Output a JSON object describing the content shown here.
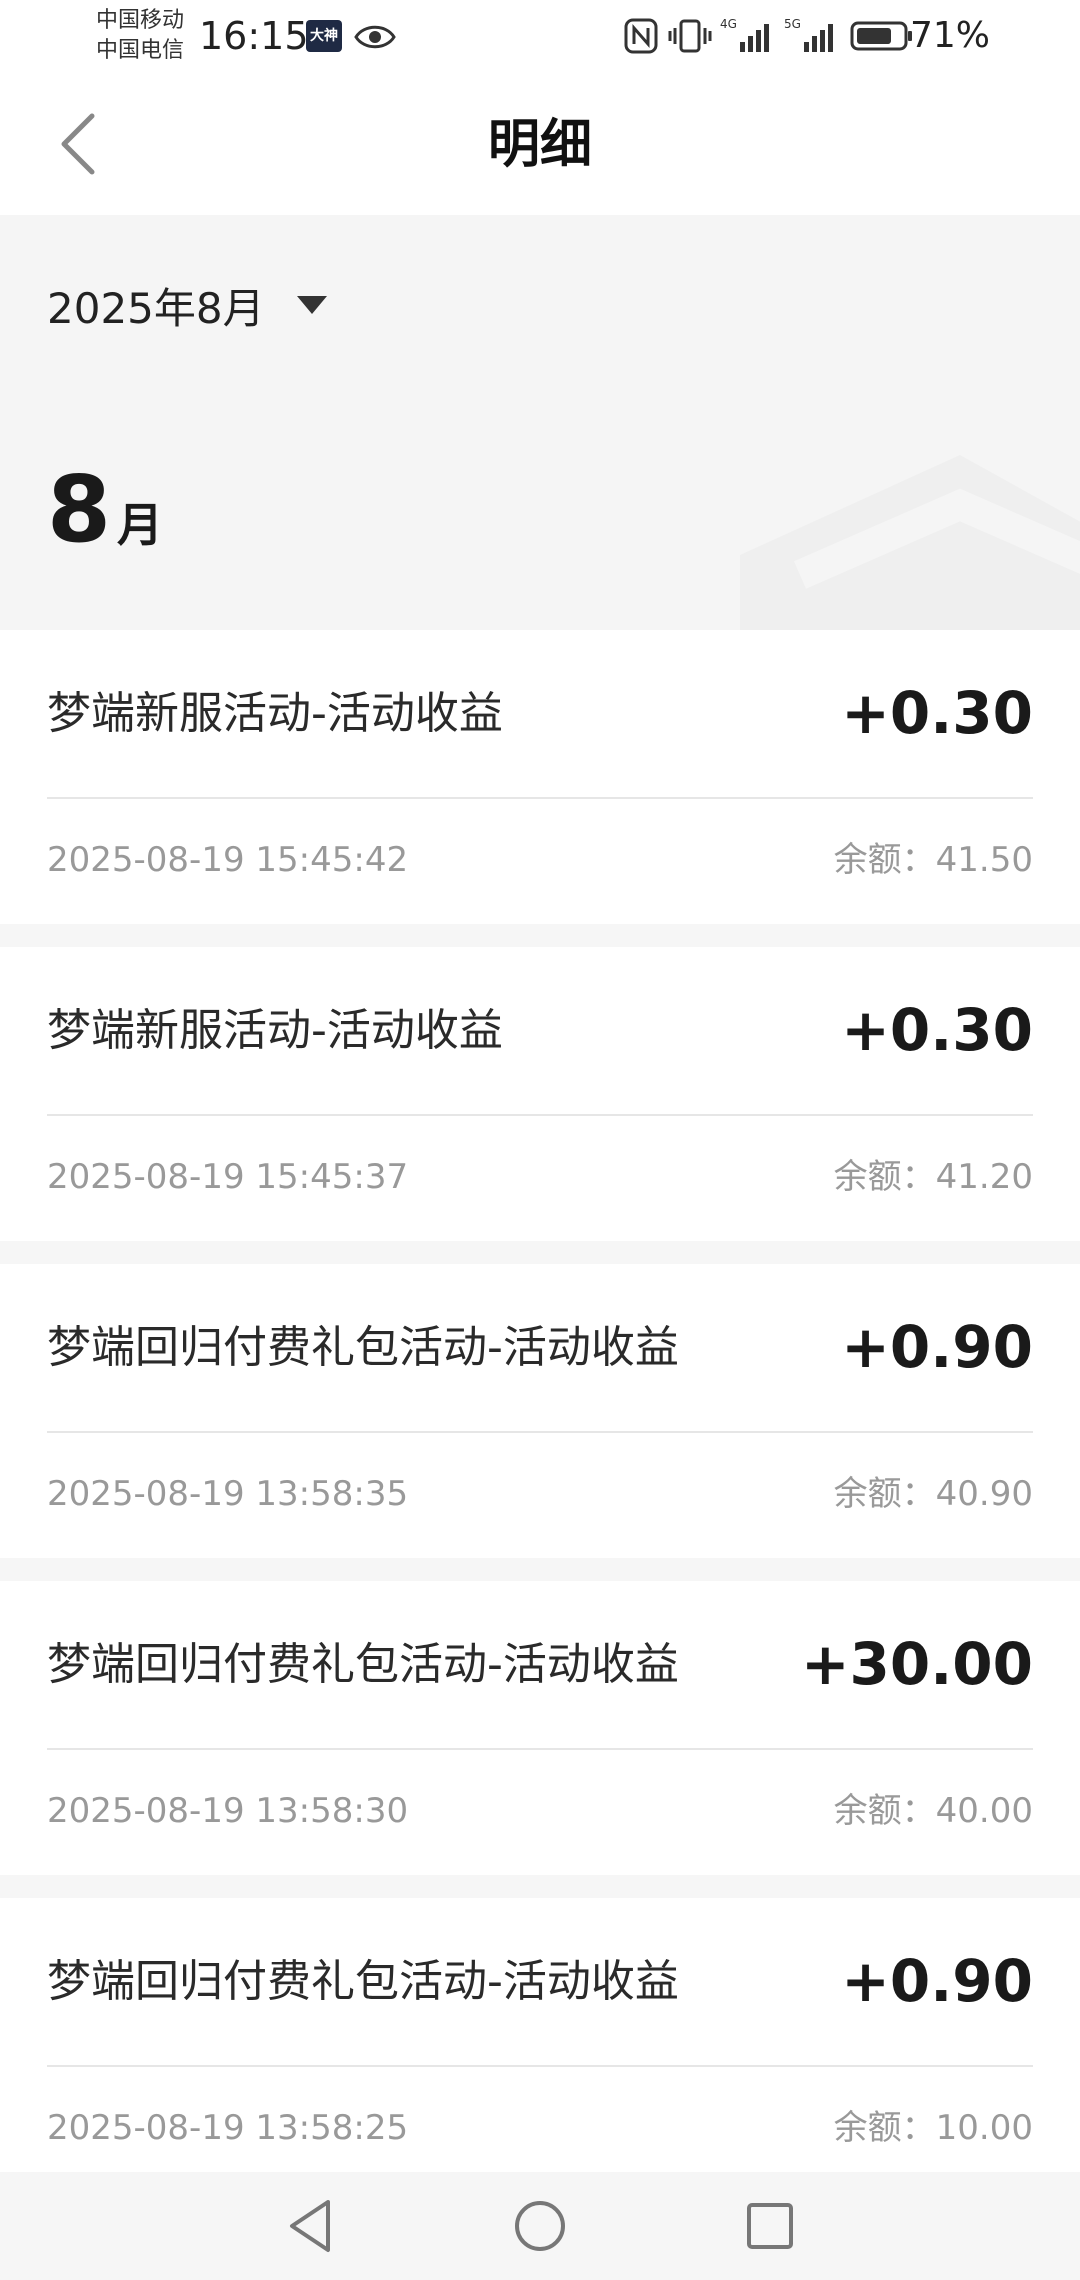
{
  "status_bar": {
    "carrier1": "中国移动",
    "carrier2": "中国电信",
    "time": "16:15",
    "app_badge": "大神",
    "battery": "71%"
  },
  "header": {
    "title": "明细"
  },
  "filter": {
    "month_label": "2025年8月"
  },
  "section": {
    "month_num": "8",
    "month_unit": "月"
  },
  "transactions": [
    {
      "title": "梦端新服活动-活动收益",
      "amount": "+0.30",
      "time": "2025-08-19 15:45:42",
      "balance": "余额：41.50"
    },
    {
      "title": "梦端新服活动-活动收益",
      "amount": "+0.30",
      "time": "2025-08-19 15:45:37",
      "balance": "余额：41.20"
    },
    {
      "title": "梦端回归付费礼包活动-活动收益",
      "amount": "+0.90",
      "time": "2025-08-19 13:58:35",
      "balance": "余额：40.90"
    },
    {
      "title": "梦端回归付费礼包活动-活动收益",
      "amount": "+30.00",
      "time": "2025-08-19 13:58:30",
      "balance": "余额：40.00"
    },
    {
      "title": "梦端回归付费礼包活动-活动收益",
      "amount": "+0.90",
      "time": "2025-08-19 13:58:25",
      "balance": "余额：10.00"
    }
  ],
  "icons": {
    "back": "chevron-left-icon",
    "dropdown": "triangle-down-icon",
    "nav_back": "nav-back-icon",
    "nav_home": "nav-home-icon",
    "nav_recent": "nav-recent-icon"
  }
}
